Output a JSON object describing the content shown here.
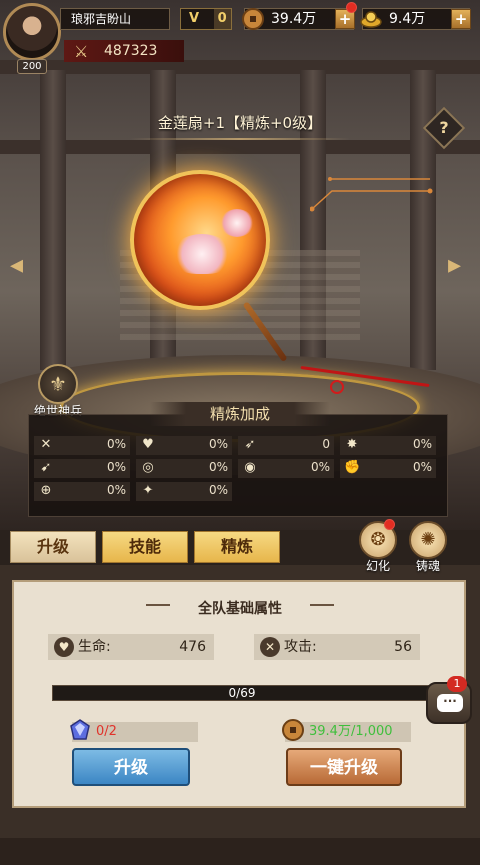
{
  "player": {
    "name": "琅邪吉盼山",
    "level": "200",
    "power": "487323"
  },
  "vip": {
    "label": "V",
    "value": "0"
  },
  "currencies": [
    {
      "name": "coin",
      "value": "39.4万"
    },
    {
      "name": "gold",
      "value": "9.4万"
    }
  ],
  "plus_symbol": "+",
  "item": {
    "title": "金莲扇+1【精炼+0级】",
    "help": "?"
  },
  "divine_weapon": {
    "label": "绝世神兵"
  },
  "refine": {
    "title": "精炼加成",
    "stats": [
      {
        "icon": "attack-icon",
        "value": "0%"
      },
      {
        "icon": "heart-icon",
        "value": "0%"
      },
      {
        "icon": "boot-icon",
        "value": "0"
      },
      {
        "icon": "crit-icon",
        "value": "0%"
      },
      {
        "icon": "wing-icon",
        "value": "0%"
      },
      {
        "icon": "swirl-icon",
        "value": "0%"
      },
      {
        "icon": "target-icon",
        "value": "0%"
      },
      {
        "icon": "strength-icon",
        "value": "0%"
      },
      {
        "icon": "aim-icon",
        "value": "0%"
      },
      {
        "icon": "dodge-icon",
        "value": "0%"
      }
    ]
  },
  "tabs": [
    {
      "label": "升级",
      "active": true
    },
    {
      "label": "技能",
      "active": false
    },
    {
      "label": "精炼",
      "active": false
    }
  ],
  "side_buttons": [
    {
      "label": "幻化"
    },
    {
      "label": "铸魂"
    }
  ],
  "team_attrs": {
    "title": "全队基础属性",
    "hp": {
      "label": "生命:",
      "value": "476"
    },
    "atk": {
      "label": "攻击:",
      "value": "56"
    }
  },
  "exp": {
    "text": "0/69",
    "progress": 0
  },
  "chat": {
    "badge": "1"
  },
  "costs": [
    {
      "name": "gem",
      "value": "0/2",
      "color": "#e0322a"
    },
    {
      "name": "coin",
      "value": "39.4万/1,000",
      "color": "#3fbf3c"
    }
  ],
  "buttons": {
    "upgrade": "升级",
    "one_key_upgrade": "一键升级"
  },
  "colors": {
    "accent_gold": "#e7b64b",
    "blue_button": "#3c86c4",
    "orange_button": "#b86a36",
    "red": "#e22d22"
  }
}
